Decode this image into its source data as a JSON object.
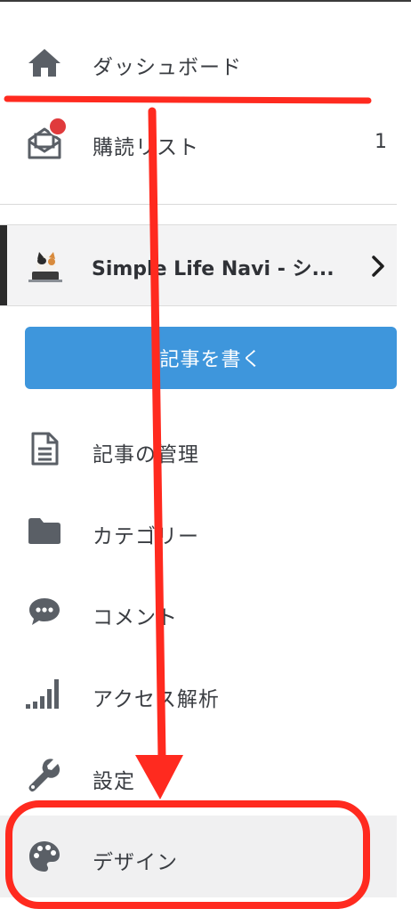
{
  "nav": {
    "dashboard": "ダッシュボード",
    "subscriptions": "購読リスト",
    "subscriptions_count": "1"
  },
  "blog": {
    "name": "Simple Life Navi - シ..."
  },
  "write_button": "記事を書く",
  "menu": {
    "manage_posts": "記事の管理",
    "categories": "カテゴリー",
    "comments": "コメント",
    "analytics": "アクセス解析",
    "settings": "設定",
    "design": "デザイン"
  },
  "colors": {
    "accent_blue": "#3e96dc",
    "annotation_red": "#ff2a1f",
    "notification_red": "#e03a3c",
    "icon_gray": "#5a5f66"
  },
  "icons": {
    "dashboard": "home-icon",
    "subscriptions": "mail-icon",
    "manage_posts": "document-icon",
    "categories": "folder-icon",
    "comments": "speech-bubble-icon",
    "analytics": "signal-bars-icon",
    "settings": "wrench-icon",
    "design": "palette-icon"
  }
}
